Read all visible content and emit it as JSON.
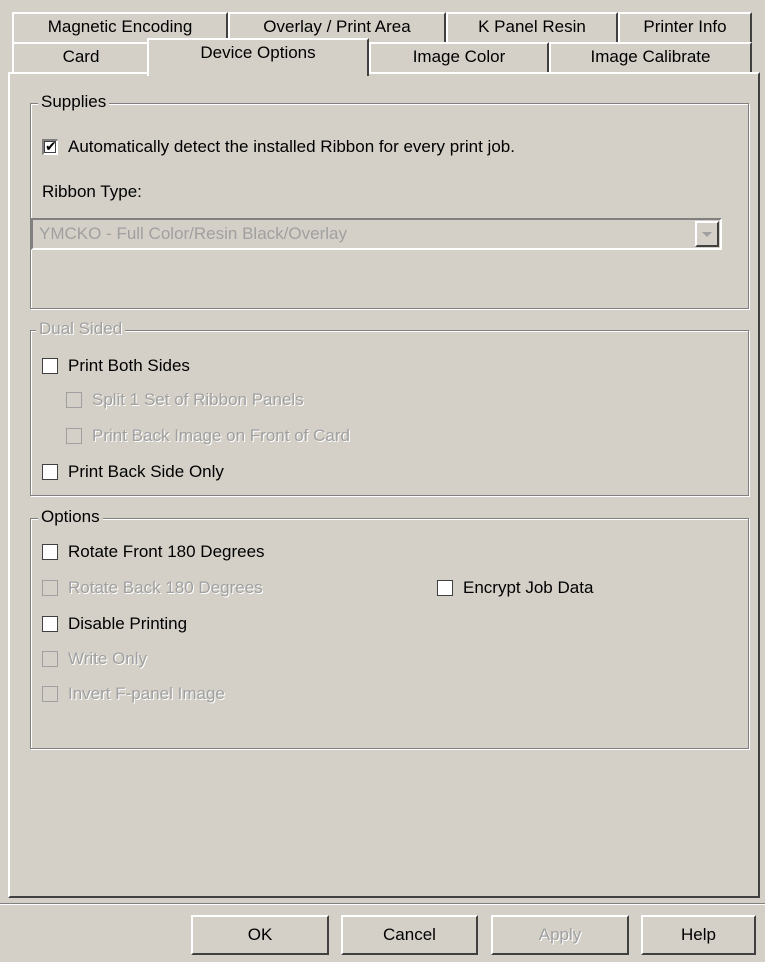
{
  "tabs": {
    "row_back": [
      {
        "label": "Magnetic Encoding"
      },
      {
        "label": "Overlay / Print Area"
      },
      {
        "label": "K Panel Resin"
      },
      {
        "label": "Printer Info"
      }
    ],
    "row_front": [
      {
        "label": "Card"
      },
      {
        "label": "Device Options",
        "active": true
      },
      {
        "label": "Image Color"
      },
      {
        "label": "Image Calibrate"
      }
    ]
  },
  "supplies": {
    "legend": "Supplies",
    "auto_detect_label": "Automatically detect the installed Ribbon for every print job.",
    "auto_detect_checked": true,
    "ribbon_type_label": "Ribbon Type:",
    "ribbon_type_value": "YMCKO - Full Color/Resin Black/Overlay"
  },
  "dual_sided": {
    "legend": "Dual Sided",
    "print_both_sides": "Print Both Sides",
    "split_ribbon": "Split 1 Set of Ribbon Panels",
    "print_back_on_front": "Print Back Image on Front of Card",
    "print_back_only": "Print Back Side Only"
  },
  "options": {
    "legend": "Options",
    "rotate_front": "Rotate Front 180 Degrees",
    "rotate_back": "Rotate Back 180 Degrees",
    "encrypt_job": "Encrypt Job Data",
    "disable_printing": "Disable Printing",
    "write_only": "Write Only",
    "invert_fpanel": "Invert F-panel Image"
  },
  "buttons": {
    "ok": "OK",
    "cancel": "Cancel",
    "apply": "Apply",
    "help": "Help"
  }
}
